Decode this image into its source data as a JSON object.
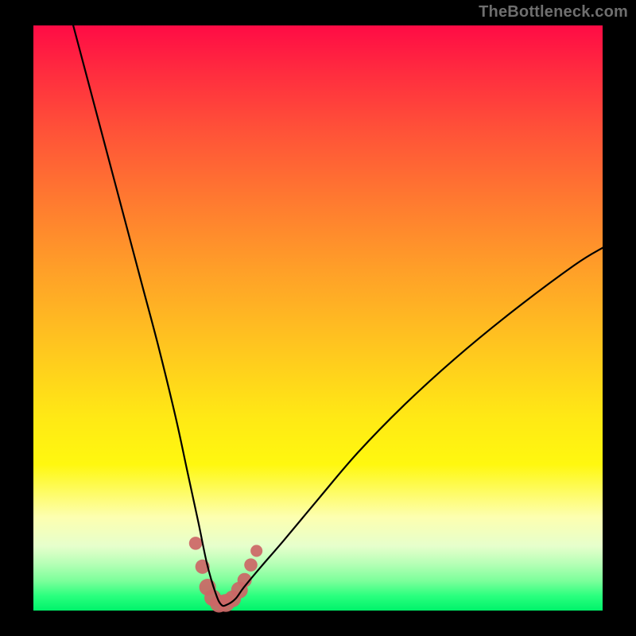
{
  "watermark": "TheBottleneck.com",
  "colors": {
    "background": "#000000",
    "curve": "#000000",
    "markers": "#cc6666",
    "gradient_top": "#ff0b45",
    "gradient_bottom": "#00f36a"
  },
  "chart_data": {
    "type": "line",
    "title": "",
    "xlabel": "",
    "ylabel": "",
    "xlim": [
      0,
      100
    ],
    "ylim": [
      0,
      100
    ],
    "annotations": [
      "TheBottleneck.com"
    ],
    "description": "Bottleneck V-curve: curve drops steeply from upper-left, reaches a minimum near x≈33, then rises again toward the right. Background vertical gradient (red→green bottom) indicates bottleneck severity; green band at bottom marks low bottleneck. Salmon-colored dot markers cluster around the curve bottom.",
    "series": [
      {
        "name": "bottleneck-curve",
        "x": [
          7,
          10,
          13,
          16,
          19,
          22,
          25,
          27,
          29,
          30.5,
          32,
          33,
          34,
          35.5,
          37,
          40,
          44,
          50,
          57,
          65,
          74,
          84,
          95,
          100
        ],
        "y": [
          100,
          89,
          78,
          67,
          56,
          45,
          33,
          24,
          15,
          8,
          3,
          1,
          1,
          2,
          4,
          7.5,
          12,
          19,
          27,
          35,
          43,
          51,
          59,
          62
        ]
      }
    ],
    "markers": {
      "name": "highlighted-points",
      "color": "#cc6666",
      "points": [
        {
          "x": 28.5,
          "y": 11.5,
          "r": 1.1
        },
        {
          "x": 29.7,
          "y": 7.5,
          "r": 1.2
        },
        {
          "x": 30.6,
          "y": 4.0,
          "r": 1.4
        },
        {
          "x": 31.5,
          "y": 2.2,
          "r": 1.4
        },
        {
          "x": 32.6,
          "y": 1.2,
          "r": 1.5
        },
        {
          "x": 33.8,
          "y": 1.3,
          "r": 1.5
        },
        {
          "x": 35.0,
          "y": 2.0,
          "r": 1.4
        },
        {
          "x": 36.2,
          "y": 3.5,
          "r": 1.4
        },
        {
          "x": 37.1,
          "y": 5.2,
          "r": 1.2
        },
        {
          "x": 38.2,
          "y": 7.8,
          "r": 1.1
        },
        {
          "x": 39.2,
          "y": 10.2,
          "r": 1.0
        }
      ]
    }
  }
}
